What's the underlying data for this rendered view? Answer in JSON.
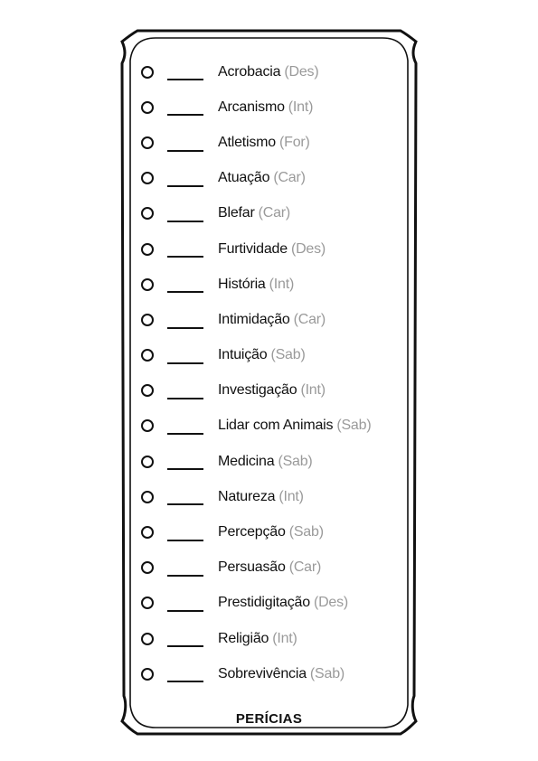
{
  "section_title": "PERÍCIAS",
  "skills": [
    {
      "name": "Acrobacia",
      "attr": "(Des)"
    },
    {
      "name": "Arcanismo",
      "attr": "(Int)"
    },
    {
      "name": "Atletismo",
      "attr": "(For)"
    },
    {
      "name": "Atuação",
      "attr": "(Car)"
    },
    {
      "name": "Blefar",
      "attr": "(Car)"
    },
    {
      "name": "Furtividade",
      "attr": "(Des)"
    },
    {
      "name": "História",
      "attr": "(Int)"
    },
    {
      "name": "Intimidação",
      "attr": "(Car)"
    },
    {
      "name": "Intuição",
      "attr": "(Sab)"
    },
    {
      "name": "Investigação",
      "attr": "(Int)"
    },
    {
      "name": "Lidar com Animais",
      "attr": "(Sab)"
    },
    {
      "name": "Medicina",
      "attr": "(Sab)"
    },
    {
      "name": "Natureza",
      "attr": "(Int)"
    },
    {
      "name": "Percepção",
      "attr": "(Sab)"
    },
    {
      "name": "Persuasão",
      "attr": "(Car)"
    },
    {
      "name": "Prestidigitação",
      "attr": "(Des)"
    },
    {
      "name": "Religião",
      "attr": "(Int)"
    },
    {
      "name": "Sobrevivência",
      "attr": "(Sab)"
    }
  ],
  "colors": {
    "ink": "#111111",
    "attribute": "#9a9a9a"
  }
}
